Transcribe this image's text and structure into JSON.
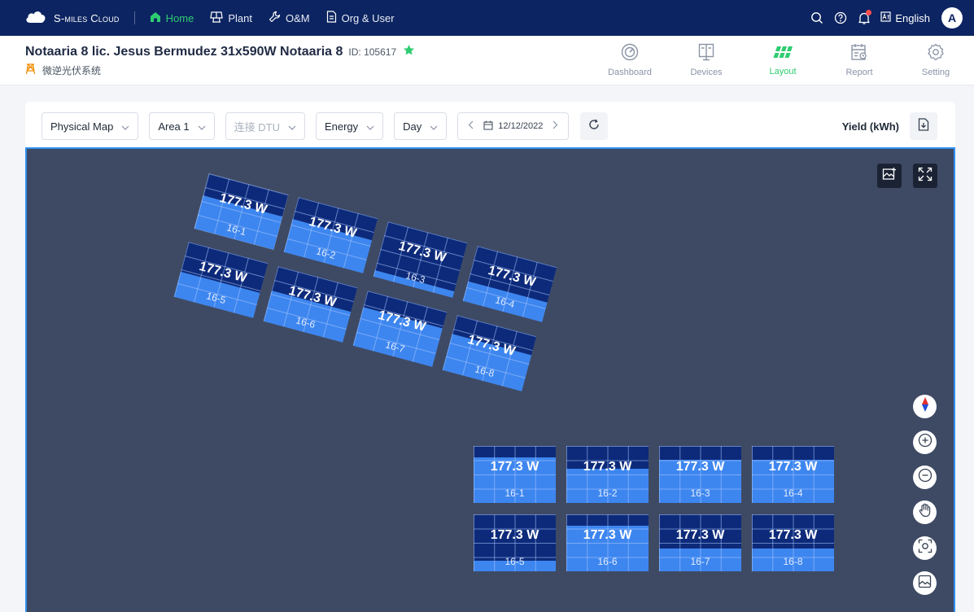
{
  "nav": {
    "brand": "S-miles Cloud",
    "items": [
      {
        "label": "Home",
        "icon": "home-icon",
        "active": true
      },
      {
        "label": "Plant",
        "icon": "plant-icon",
        "active": false
      },
      {
        "label": "O&M",
        "icon": "wrench-icon",
        "active": false
      },
      {
        "label": "Org & User",
        "icon": "document-icon",
        "active": false
      }
    ],
    "language": "English",
    "avatar": "A"
  },
  "header": {
    "plant_name": "Notaaria 8 lic. Jesus Bermudez 31x590W Notaaria 8",
    "plant_id": "ID: 105617",
    "plant_type": "微逆光伏系统",
    "tabs": [
      {
        "label": "Dashboard",
        "icon": "dashboard-icon",
        "active": false
      },
      {
        "label": "Devices",
        "icon": "devices-icon",
        "active": false
      },
      {
        "label": "Layout",
        "icon": "layout-icon",
        "active": true
      },
      {
        "label": "Report",
        "icon": "report-icon",
        "active": false
      },
      {
        "label": "Setting",
        "icon": "gear-icon",
        "active": false
      }
    ]
  },
  "toolbar": {
    "map_type": "Physical Map",
    "area": "Area 1",
    "dtu_placeholder": "连接 DTU",
    "metric": "Energy",
    "period": "Day",
    "date": "12/12/2022",
    "yield_label": "Yield (kWh)"
  },
  "colors": {
    "nav_bg": "#0c2461",
    "accent_green": "#2ecc71",
    "map_bg": "#3e4a64",
    "panel_dark": "#0d2a7a",
    "panel_light": "#3d86ef",
    "map_border": "#2f8ff0"
  },
  "panels_rotated": [
    {
      "power": "177.3 W",
      "id": "16-1",
      "fill": 0.6,
      "selected": true
    },
    {
      "power": "177.3 W",
      "id": "16-2",
      "fill": 0.6,
      "selected": false
    },
    {
      "power": "177.3 W",
      "id": "16-3",
      "fill": 0.12,
      "selected": false
    },
    {
      "power": "177.3 W",
      "id": "16-4",
      "fill": 0.35,
      "selected": false
    },
    {
      "power": "177.3 W",
      "id": "16-5",
      "fill": 0.45,
      "selected": false
    },
    {
      "power": "177.3 W",
      "id": "16-6",
      "fill": 0.55,
      "selected": false
    },
    {
      "power": "177.3 W",
      "id": "16-7",
      "fill": 0.7,
      "selected": false
    },
    {
      "power": "177.3 W",
      "id": "16-8",
      "fill": 0.65,
      "selected": false
    }
  ],
  "panels_grid": [
    {
      "power": "177.3 W",
      "id": "16-1",
      "fill": 0.8
    },
    {
      "power": "177.3 W",
      "id": "16-2",
      "fill": 0.6
    },
    {
      "power": "177.3 W",
      "id": "16-3",
      "fill": 0.75
    },
    {
      "power": "177.3 W",
      "id": "16-4",
      "fill": 0.75
    },
    {
      "power": "177.3 W",
      "id": "16-5",
      "fill": 0.18
    },
    {
      "power": "177.3 W",
      "id": "16-6",
      "fill": 0.8
    },
    {
      "power": "177.3 W",
      "id": "16-7",
      "fill": 0.4
    },
    {
      "power": "177.3 W",
      "id": "16-8",
      "fill": 0.4
    }
  ]
}
